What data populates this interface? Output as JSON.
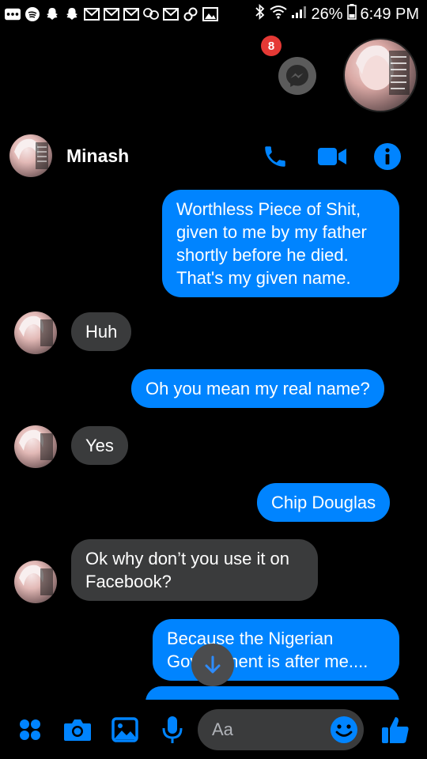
{
  "status_bar": {
    "battery": "26%",
    "time": "6:49 PM"
  },
  "chat_heads": {
    "badge_count": "8"
  },
  "header": {
    "contact_name": "Minash"
  },
  "messages": [
    {
      "side": "sent",
      "text": "Worthless Piece of Shit, given to me by my father shortly before he died. That's my given name."
    },
    {
      "side": "received",
      "text": "Huh"
    },
    {
      "side": "sent",
      "text": "Oh you mean my real name?"
    },
    {
      "side": "received",
      "text": "Yes"
    },
    {
      "side": "sent",
      "text": "Chip Douglas"
    },
    {
      "side": "received",
      "text": "Ok why don’t you use it on Facebook?"
    },
    {
      "side": "sent",
      "text": "Because the Nigerian Government is after me...."
    }
  ],
  "composer": {
    "placeholder": "Aa"
  },
  "colors": {
    "accent": "#0084ff",
    "received_bubble": "#3a3b3c",
    "badge": "#e53935"
  }
}
